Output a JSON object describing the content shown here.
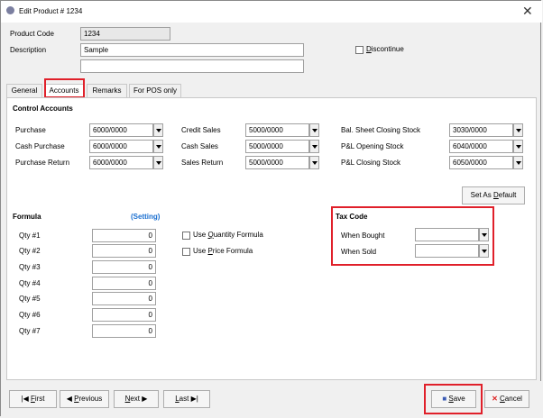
{
  "window": {
    "title": "Edit Product # 1234"
  },
  "header": {
    "product_code_label": "Product Code",
    "product_code_value": "1234",
    "description_label": "Description",
    "description_value": "Sample",
    "description2_value": "",
    "discontinue_label": "Discontinue"
  },
  "tabs": [
    {
      "label": "General"
    },
    {
      "label": "Accounts"
    },
    {
      "label": "Remarks"
    },
    {
      "label": "For POS only"
    }
  ],
  "accounts": {
    "section_title": "Control Accounts",
    "col1": [
      {
        "label": "Purchase",
        "value": "6000/0000"
      },
      {
        "label": "Cash Purchase",
        "value": "6000/0000"
      },
      {
        "label": "Purchase Return",
        "value": "6000/0000"
      }
    ],
    "col2": [
      {
        "label": "Credit Sales",
        "value": "5000/0000"
      },
      {
        "label": "Cash Sales",
        "value": "5000/0000"
      },
      {
        "label": "Sales Return",
        "value": "5000/0000"
      }
    ],
    "col3": [
      {
        "label": "Bal. Sheet Closing Stock",
        "value": "3030/0000"
      },
      {
        "label": "P&L Opening Stock",
        "value": "6040/0000"
      },
      {
        "label": "P&L Closing Stock",
        "value": "6050/0000"
      }
    ],
    "set_default_label": "Set As Default"
  },
  "formula": {
    "title": "Formula",
    "setting_link": "(Setting)",
    "rows": [
      {
        "label": "Qty #1",
        "value": "0"
      },
      {
        "label": "Qty #2",
        "value": "0"
      },
      {
        "label": "Qty #3",
        "value": "0"
      },
      {
        "label": "Qty #4",
        "value": "0"
      },
      {
        "label": "Qty #5",
        "value": "0"
      },
      {
        "label": "Qty #6",
        "value": "0"
      },
      {
        "label": "Qty #7",
        "value": "0"
      }
    ],
    "use_qty_formula": "Use Quantity Formula",
    "use_price_formula": "Use Price Formula"
  },
  "tax": {
    "title": "Tax Code",
    "when_bought_label": "When Bought",
    "when_bought_value": "",
    "when_sold_label": "When Sold",
    "when_sold_value": ""
  },
  "footer": {
    "first": "First",
    "previous": "Previous",
    "next": "Next",
    "last": "Last",
    "save": "Save",
    "cancel": "Cancel"
  },
  "colors": {
    "highlight": "#e0202a",
    "link": "#1a6fd0"
  }
}
